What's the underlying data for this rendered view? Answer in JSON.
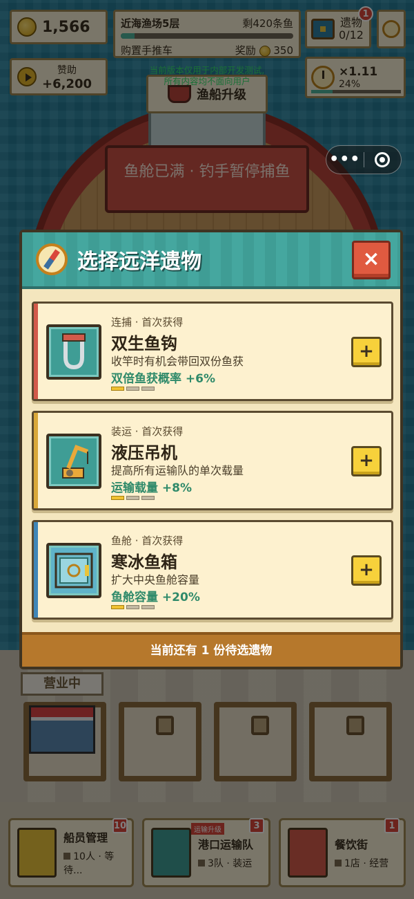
{
  "hud": {
    "coins": "1,566",
    "level": {
      "title": "近海渔场5层",
      "remaining": "剩420条鱼",
      "progress_fraction": 0.08,
      "task": "购置手推车",
      "reward_label": "奖励",
      "reward_value": "350"
    },
    "relics": {
      "label": "遗物",
      "count": "0/12",
      "badge": "1"
    },
    "sponsor": {
      "label": "赞助",
      "amount": "+6,200"
    },
    "boost": {
      "multiplier": "×1.11",
      "percent": "24%",
      "progress_fraction": 0.24
    },
    "dev_note_line1": "当前版本仅用于内部开发测试,",
    "dev_note_line2": "所有内容均不面向用户",
    "upgrade_button": "渔船升级",
    "hold_banner": "鱼舱已满 · 钓手暂停捕鱼"
  },
  "miniprogram_capsule": {
    "more": "•••"
  },
  "dock": {
    "open_tag": "营业中"
  },
  "modal": {
    "title": "选择远洋遗物",
    "close": "×",
    "cards": [
      {
        "category": "连捕 · 首次获得",
        "name": "双生鱼钩",
        "description": "收竿时有机会带回双份鱼获",
        "effect": "双倍鱼获概率 +6%",
        "level": 1,
        "max_level": 3,
        "button": "+"
      },
      {
        "category": "装运 · 首次获得",
        "name": "液压吊机",
        "description": "提高所有运输队的单次载量",
        "effect": "运输载量 +8%",
        "level": 1,
        "max_level": 3,
        "button": "+"
      },
      {
        "category": "鱼舱 · 首次获得",
        "name": "寒冰鱼箱",
        "description": "扩大中央鱼舱容量",
        "effect": "鱼舱容量 +20%",
        "level": 1,
        "max_level": 3,
        "button": "+"
      }
    ],
    "footer": "当前还有 1 份待选遗物"
  },
  "tabs": [
    {
      "name": "船员管理",
      "sub": "10人 · 等待...",
      "badge": "10",
      "icon": "crew-icon"
    },
    {
      "name": "港口运输队",
      "sub": "3队 · 装运",
      "badge": "3",
      "tag": "运输升级",
      "icon": "truck-icon"
    },
    {
      "name": "餐饮街",
      "sub": "1店 · 经营",
      "badge": "1",
      "icon": "food-stall-icon"
    }
  ]
}
